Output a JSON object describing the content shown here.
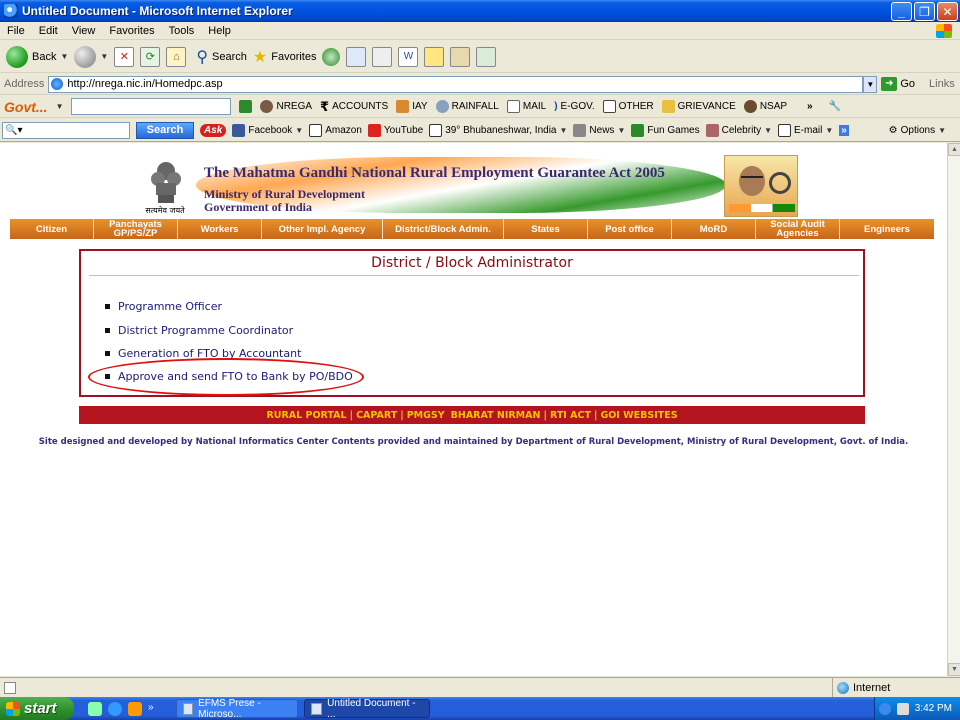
{
  "window": {
    "title": "Untitled Document - Microsoft Internet Explorer"
  },
  "menu": [
    "File",
    "Edit",
    "View",
    "Favorites",
    "Tools",
    "Help"
  ],
  "toolbar": {
    "back": "Back",
    "search": "Search",
    "favorites": "Favorites"
  },
  "address": {
    "label": "Address",
    "url": "http://nrega.nic.in/Homedpc.asp",
    "go": "Go",
    "links": "Links"
  },
  "govbar": {
    "logo": "Govt...",
    "items": [
      "NREGA",
      "ACCOUNTS",
      "IAY",
      "RAINFALL",
      "MAIL",
      "E-GOV.",
      "OTHER",
      "GRIEVANCE",
      "NSAP"
    ]
  },
  "askbar": {
    "search_button": "Search",
    "ask_logo": "Ask",
    "items": [
      "Facebook",
      "Amazon",
      "YouTube",
      "39° Bhubaneshwar, India",
      "News",
      "Fun Games",
      "Celebrity",
      "E-mail"
    ],
    "options": "Options"
  },
  "banner": {
    "title": "The Mahatma Gandhi National Rural Employment Guarantee Act 2005",
    "line1": "Ministry of Rural Development",
    "line2": "Government of India",
    "emblem_caption": "सत्यमेव जयते"
  },
  "nav": [
    {
      "label": "Citizen"
    },
    {
      "label": "Panchayats GP/PS/ZP"
    },
    {
      "label": "Workers"
    },
    {
      "label": "Other Impl. Agency"
    },
    {
      "label": "District/Block Admin."
    },
    {
      "label": "States"
    },
    {
      "label": "Post office"
    },
    {
      "label": "MoRD"
    },
    {
      "label": "Social Audit Agencies"
    },
    {
      "label": "Engineers"
    }
  ],
  "panel": {
    "title": "District / Block Administrator",
    "links": [
      "Programme Officer",
      "District Programme Coordinator",
      "Generation of FTO by Accountant",
      "Approve and send FTO to Bank by PO/BDO"
    ]
  },
  "footer_links": [
    "RURAL PORTAL",
    "CAPART",
    "PMGSY",
    "BHARAT NIRMAN",
    "RTI ACT",
    "GOI WEBSITES"
  ],
  "credit": "Site designed and developed by National Informatics Center Contents provided and maintained by Department of Rural Development, Ministry of Rural Development, Govt. of India.",
  "status": {
    "zone": "Internet"
  },
  "taskbar": {
    "start": "start",
    "tasks": [
      "EFMS Prese - Microso...",
      "Untitled Document - ..."
    ],
    "clock": "3:42 PM"
  }
}
